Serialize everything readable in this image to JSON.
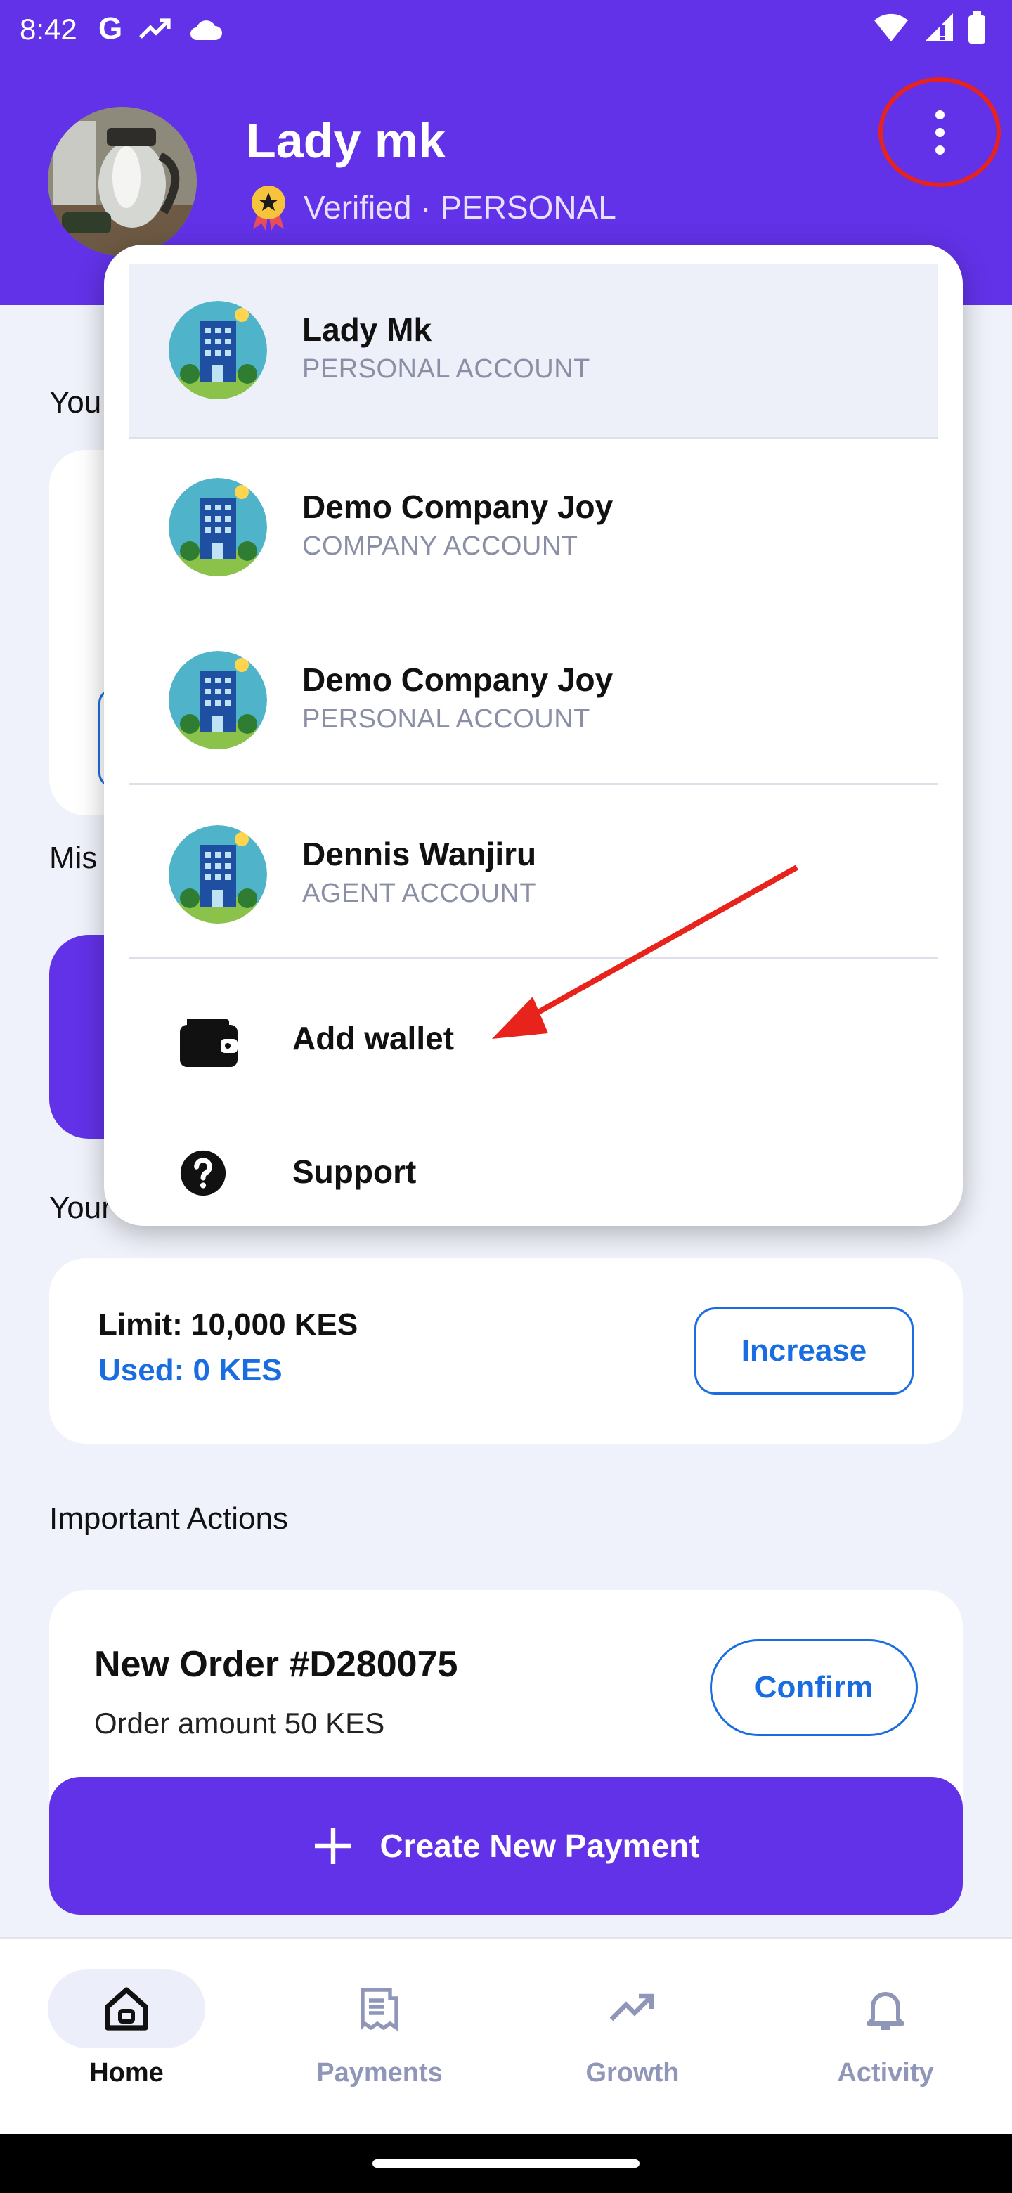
{
  "status_bar": {
    "time": "8:42"
  },
  "profile": {
    "name": "Lady mk",
    "verified_text": "Verified · PERSONAL"
  },
  "background": {
    "section_1_label": "You",
    "section_2_label": "Mis",
    "section_3_label": "Your",
    "limit": {
      "limit_text": "Limit: 10,000 KES",
      "used_text": "Used: 0 KES",
      "increase_label": "Increase"
    },
    "important_actions_label": "Important Actions",
    "order": {
      "title": "New Order #D280075",
      "subtitle": "Order amount 50 KES",
      "confirm_label": "Confirm"
    },
    "create_payment_label": "Create New Payment"
  },
  "account_menu": {
    "accounts": [
      {
        "name": "Lady Mk",
        "type": "PERSONAL ACCOUNT",
        "selected": true
      },
      {
        "name": "Demo Company Joy",
        "type": "COMPANY ACCOUNT",
        "selected": false
      },
      {
        "name": "Demo Company Joy",
        "type": "PERSONAL ACCOUNT",
        "selected": false
      },
      {
        "name": "Dennis Wanjiru",
        "type": "AGENT ACCOUNT",
        "selected": false
      }
    ],
    "add_wallet_label": "Add wallet",
    "support_label": "Support"
  },
  "bottom_nav": {
    "items": [
      {
        "label": "Home",
        "icon": "home-icon",
        "active": true
      },
      {
        "label": "Payments",
        "icon": "receipt-icon",
        "active": false
      },
      {
        "label": "Growth",
        "icon": "trending-up-icon",
        "active": false
      },
      {
        "label": "Activity",
        "icon": "bell-icon",
        "active": false
      }
    ]
  },
  "colors": {
    "brand_purple": "#6232e8",
    "link_blue": "#1a6de0",
    "annotation_red": "#e8231b",
    "muted_text": "#8a8fa6"
  }
}
